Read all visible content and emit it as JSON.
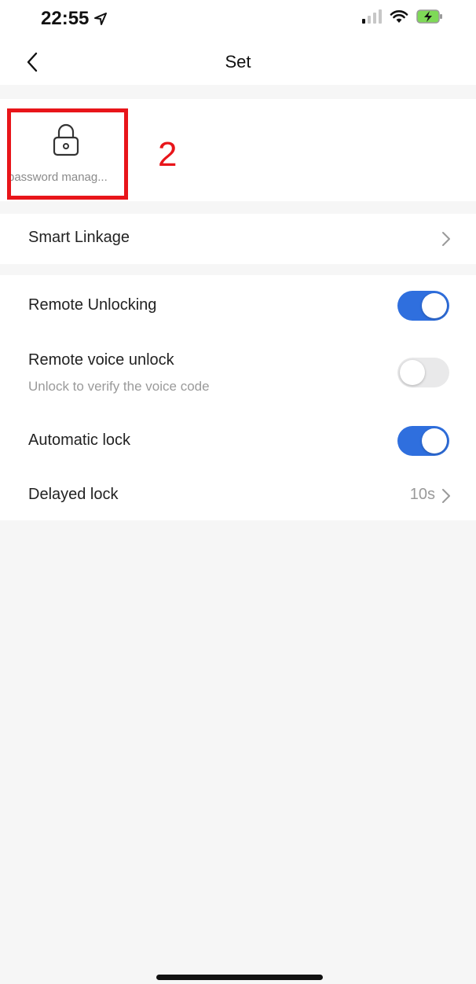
{
  "status_bar": {
    "time": "22:55",
    "icons": [
      "location-arrow-icon",
      "signal-icon",
      "wifi-icon",
      "battery-charging-icon"
    ]
  },
  "nav": {
    "title": "Set",
    "back_icon": "chevron-left-icon"
  },
  "quick_actions": [
    {
      "label": "password manag...",
      "icon": "lock-icon"
    }
  ],
  "annotation": {
    "number": "2",
    "color": "#e8151a"
  },
  "linkage": {
    "label": "Smart Linkage",
    "icon": "chevron-right-icon"
  },
  "settings": {
    "remote_unlocking": {
      "label": "Remote Unlocking",
      "enabled": true
    },
    "remote_voice_unlock": {
      "label": "Remote voice unlock",
      "sublabel": "Unlock to verify the voice code",
      "enabled": false
    },
    "automatic_lock": {
      "label": "Automatic lock",
      "enabled": true
    },
    "delayed_lock": {
      "label": "Delayed lock",
      "value": "10s"
    }
  },
  "colors": {
    "accent": "#2f6fde",
    "background": "#f6f6f6",
    "toggle_off": "#e9e9ea"
  }
}
